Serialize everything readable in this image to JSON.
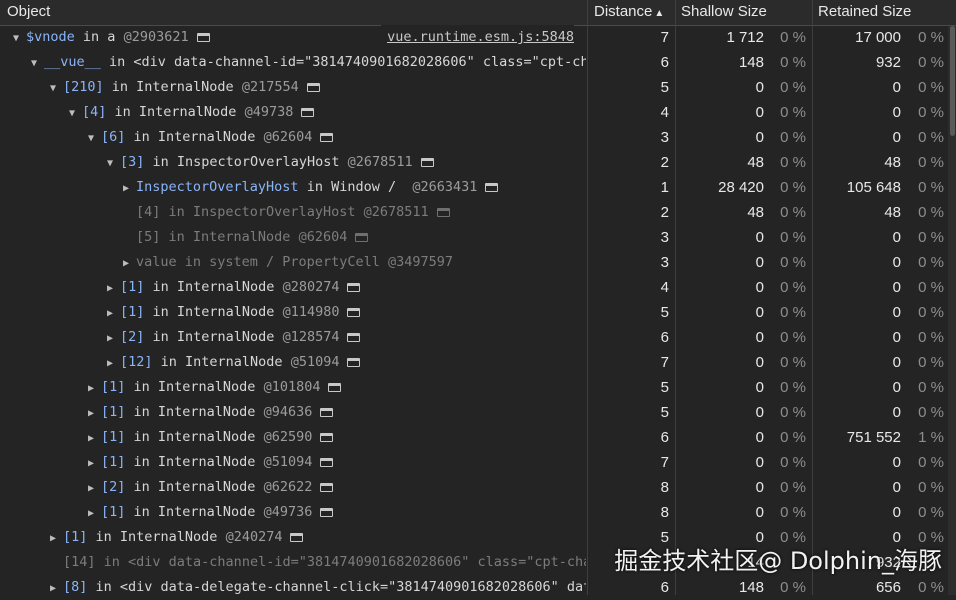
{
  "header": {
    "object": "Object",
    "distance": "Distance",
    "distance_sort": "▲",
    "shallow": "Shallow Size",
    "retained": "Retained Size"
  },
  "rows": [
    {
      "tri": "▼",
      "label": "$vnode",
      "text": " in a ",
      "addr": "@2903621",
      "icon": true,
      "link": "vue.runtime.esm.js:5848",
      "dist": "7",
      "sh": "1 712",
      "shp": "0 %",
      "rt": "17 000",
      "rtp": "0 %"
    },
    {
      "tri": "▼",
      "label": "__vue__",
      "text": " in <div data-channel-id=\"3814740901682028606\" class=\"cpt-chan",
      "addr": "",
      "icon": false,
      "dist": "6",
      "sh": "148",
      "shp": "0 %",
      "rt": "932",
      "rtp": "0 %"
    },
    {
      "tri": "▼",
      "label": "[210]",
      "text": " in InternalNode ",
      "addr": "@217554",
      "icon": true,
      "dist": "5",
      "sh": "0",
      "shp": "0 %",
      "rt": "0",
      "rtp": "0 %"
    },
    {
      "tri": "▼",
      "label": "[4]",
      "text": " in InternalNode ",
      "addr": "@49738",
      "icon": true,
      "dist": "4",
      "sh": "0",
      "shp": "0 %",
      "rt": "0",
      "rtp": "0 %"
    },
    {
      "tri": "▼",
      "label": "[6]",
      "text": " in InternalNode ",
      "addr": "@62604",
      "icon": true,
      "dist": "3",
      "sh": "0",
      "shp": "0 %",
      "rt": "0",
      "rtp": "0 %"
    },
    {
      "tri": "▼",
      "label": "[3]",
      "text": " in InspectorOverlayHost ",
      "addr": "@2678511",
      "icon": true,
      "dist": "2",
      "sh": "48",
      "shp": "0 %",
      "rt": "48",
      "rtp": "0 %"
    },
    {
      "tri": "▶",
      "label": "InspectorOverlayHost",
      "text": " in Window /  ",
      "addr": "@2663431",
      "icon": true,
      "dist": "1",
      "sh": "28 420",
      "shp": "0 %",
      "rt": "105 648",
      "rtp": "0 %"
    },
    {
      "tri": "",
      "label": "[4]",
      "text": " in InspectorOverlayHost ",
      "addr": "@2678511",
      "icon": true,
      "dim": true,
      "dist": "2",
      "sh": "48",
      "shp": "0 %",
      "rt": "48",
      "rtp": "0 %"
    },
    {
      "tri": "",
      "label": "[5]",
      "text": " in InternalNode ",
      "addr": "@62604",
      "icon": true,
      "dim": true,
      "dist": "3",
      "sh": "0",
      "shp": "0 %",
      "rt": "0",
      "rtp": "0 %"
    },
    {
      "tri": "▶",
      "label": "value",
      "text": " in system / PropertyCell ",
      "addr": "@3497597",
      "icon": false,
      "dim": true,
      "dist": "3",
      "sh": "0",
      "shp": "0 %",
      "rt": "0",
      "rtp": "0 %"
    },
    {
      "tri": "▶",
      "label": "[1]",
      "text": " in InternalNode ",
      "addr": "@280274",
      "icon": true,
      "dist": "4",
      "sh": "0",
      "shp": "0 %",
      "rt": "0",
      "rtp": "0 %"
    },
    {
      "tri": "▶",
      "label": "[1]",
      "text": " in InternalNode ",
      "addr": "@114980",
      "icon": true,
      "dist": "5",
      "sh": "0",
      "shp": "0 %",
      "rt": "0",
      "rtp": "0 %"
    },
    {
      "tri": "▶",
      "label": "[2]",
      "text": " in InternalNode ",
      "addr": "@128574",
      "icon": true,
      "dist": "6",
      "sh": "0",
      "shp": "0 %",
      "rt": "0",
      "rtp": "0 %"
    },
    {
      "tri": "▶",
      "label": "[12]",
      "text": " in InternalNode ",
      "addr": "@51094",
      "icon": true,
      "dist": "7",
      "sh": "0",
      "shp": "0 %",
      "rt": "0",
      "rtp": "0 %"
    },
    {
      "tri": "▶",
      "label": "[1]",
      "text": " in InternalNode ",
      "addr": "@101804",
      "icon": true,
      "dist": "5",
      "sh": "0",
      "shp": "0 %",
      "rt": "0",
      "rtp": "0 %"
    },
    {
      "tri": "▶",
      "label": "[1]",
      "text": " in InternalNode ",
      "addr": "@94636",
      "icon": true,
      "dist": "5",
      "sh": "0",
      "shp": "0 %",
      "rt": "0",
      "rtp": "0 %"
    },
    {
      "tri": "▶",
      "label": "[1]",
      "text": " in InternalNode ",
      "addr": "@62590",
      "icon": true,
      "dist": "6",
      "sh": "0",
      "shp": "0 %",
      "rt": "751 552",
      "rtp": "1 %"
    },
    {
      "tri": "▶",
      "label": "[1]",
      "text": " in InternalNode ",
      "addr": "@51094",
      "icon": true,
      "dist": "7",
      "sh": "0",
      "shp": "0 %",
      "rt": "0",
      "rtp": "0 %"
    },
    {
      "tri": "▶",
      "label": "[2]",
      "text": " in InternalNode ",
      "addr": "@62622",
      "icon": true,
      "dist": "8",
      "sh": "0",
      "shp": "0 %",
      "rt": "0",
      "rtp": "0 %"
    },
    {
      "tri": "▶",
      "label": "[1]",
      "text": " in InternalNode ",
      "addr": "@49736",
      "icon": true,
      "dist": "8",
      "sh": "0",
      "shp": "0 %",
      "rt": "0",
      "rtp": "0 %"
    },
    {
      "tri": "▶",
      "label": "[1]",
      "text": " in InternalNode ",
      "addr": "@240274",
      "icon": true,
      "dist": "5",
      "sh": "0",
      "shp": "0 %",
      "rt": "0",
      "rtp": "0 %"
    },
    {
      "tri": "",
      "label": "[14]",
      "text": " in <div data-channel-id=\"3814740901682028606\" class=\"cpt-chan",
      "addr": "",
      "icon": false,
      "dim": true,
      "dist": "",
      "sh": "14",
      "shp": "",
      "rt": "932",
      "rtp": ""
    },
    {
      "tri": "▶",
      "label": "[8]",
      "text": " in <div data-delegate-channel-click=\"3814740901682028606\" data-",
      "addr": "",
      "icon": false,
      "dist": "6",
      "sh": "148",
      "shp": "0 %",
      "rt": "656",
      "rtp": "0 %"
    }
  ],
  "watermark": "掘金技术社区@ Dolphin_海豚"
}
